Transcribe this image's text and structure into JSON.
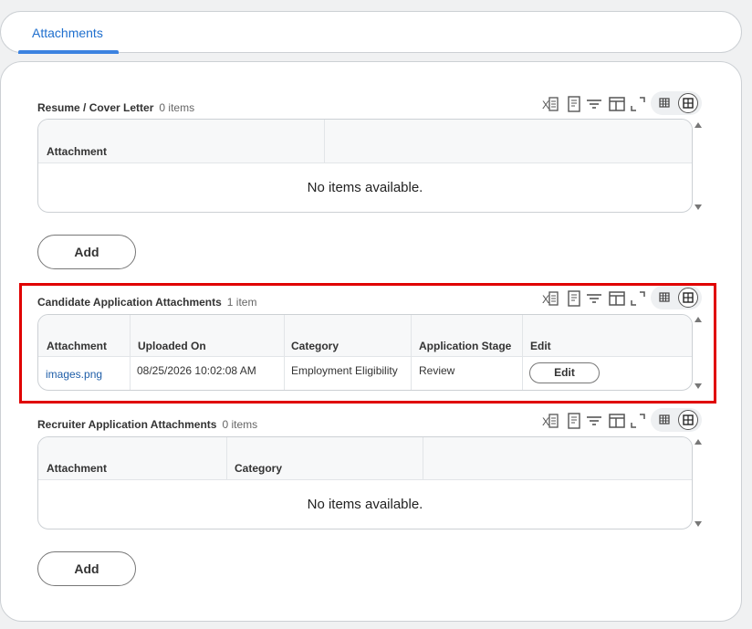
{
  "tabs": [
    {
      "label": "Attachments",
      "active": true
    }
  ],
  "sections": {
    "resume": {
      "title": "Resume / Cover Letter",
      "count": "0 items",
      "columns": [
        "Attachment"
      ],
      "empty_message": "No items available.",
      "add_label": "Add"
    },
    "candidate": {
      "title": "Candidate Application Attachments",
      "count": "1 item",
      "columns": [
        "Attachment",
        "Uploaded On",
        "Category",
        "Application Stage",
        "Edit"
      ],
      "rows": [
        {
          "attachment": "images.png",
          "uploaded_on": "08/25/2026 10:02:08 AM",
          "category": "Employment Eligibility",
          "stage": "Review",
          "edit_label": "Edit"
        }
      ]
    },
    "recruiter": {
      "title": "Recruiter Application Attachments",
      "count": "0 items",
      "columns": [
        "Attachment",
        "Category"
      ],
      "empty_message": "No items available.",
      "add_label": "Add"
    }
  },
  "toolbar_icons": [
    "export-excel-icon",
    "export-pdf-icon",
    "filter-icon",
    "column-chooser-icon",
    "fullscreen-icon",
    "table-view-icon",
    "grid-view-icon"
  ],
  "colors": {
    "accent": "#1f6fce",
    "highlight": "#e00000",
    "link": "#1f5ea8"
  }
}
